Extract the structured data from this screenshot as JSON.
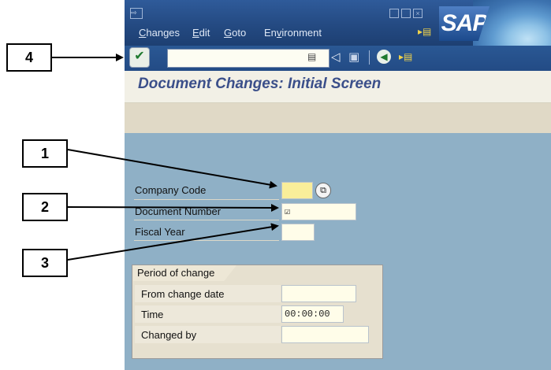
{
  "menu": {
    "items": [
      {
        "mnemonic": "C",
        "rest": "hanges"
      },
      {
        "mnemonic": "E",
        "rest": "dit"
      },
      {
        "mnemonic": "G",
        "rest": "oto"
      },
      {
        "pre": "En",
        "mnemonic": "v",
        "rest": "ironment"
      }
    ],
    "logo": "SAP"
  },
  "toolbar": {
    "command_field_value": ""
  },
  "screen": {
    "title": "Document Changes: Initial Screen"
  },
  "form": {
    "company_code": {
      "label": "Company Code",
      "value": ""
    },
    "document_number": {
      "label": "Document Number",
      "value": "☑"
    },
    "fiscal_year": {
      "label": "Fiscal Year",
      "value": ""
    }
  },
  "period_group": {
    "title": "Period of change",
    "from_change_date": {
      "label": "From change date",
      "value": ""
    },
    "time": {
      "label": "Time",
      "value": "00:00:00"
    },
    "changed_by": {
      "label": "Changed by",
      "value": ""
    }
  },
  "annotations": [
    "4",
    "1",
    "2",
    "3"
  ]
}
